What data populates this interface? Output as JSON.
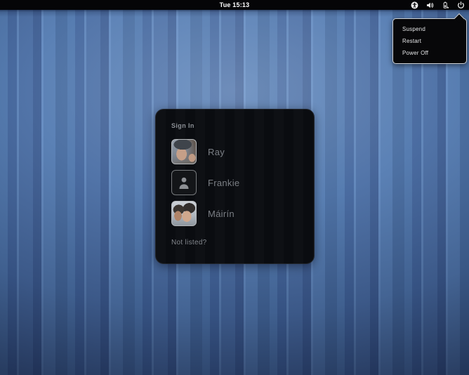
{
  "top_bar": {
    "clock": "Tue 15:13",
    "icons": [
      {
        "name": "accessibility-icon"
      },
      {
        "name": "volume-icon"
      },
      {
        "name": "battery-icon"
      },
      {
        "name": "power-icon"
      }
    ]
  },
  "power_menu": {
    "items": [
      {
        "label": "Suspend"
      },
      {
        "label": "Restart"
      },
      {
        "label": "Power Off"
      }
    ]
  },
  "sign_in": {
    "title": "Sign In",
    "users": [
      {
        "name": "Ray",
        "avatar": "photo-man-with-cap"
      },
      {
        "name": "Frankie",
        "avatar": "generic-person-silhouette"
      },
      {
        "name": "Máirín",
        "avatar": "photo-two-people"
      }
    ],
    "not_listed": "Not listed?"
  },
  "colors": {
    "wallpaper_blue": "#4a6da3",
    "wallpaper_light_stripe": "#6289bf",
    "wallpaper_dark_stripe": "#3e5d92",
    "top_bar_bg": "#050507",
    "dialog_bg": "#0a0c10",
    "menu_bg": "#070709",
    "menu_border": "#cfd2d6",
    "muted_text": "#7b7f85"
  }
}
